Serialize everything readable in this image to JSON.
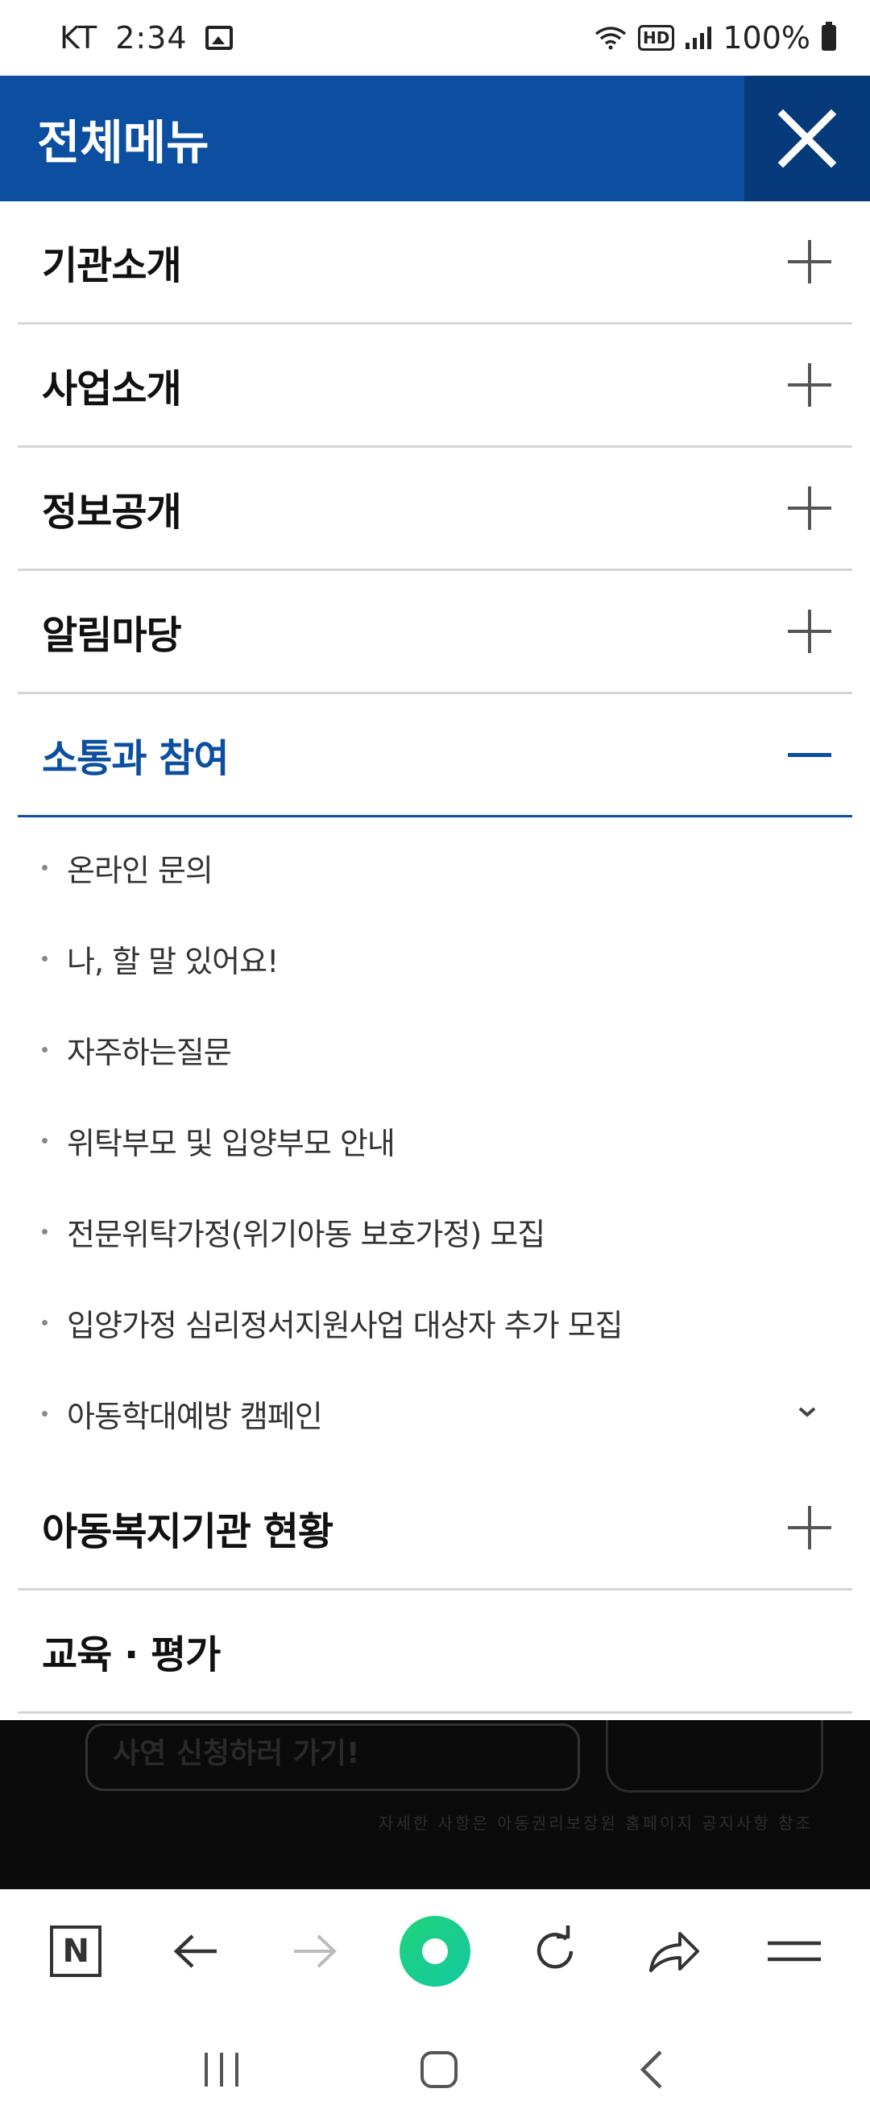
{
  "status_bar": {
    "carrier": "KT",
    "time": "2:34",
    "battery": "100%"
  },
  "header": {
    "title": "전체메뉴"
  },
  "menu": {
    "items": [
      {
        "label": "기관소개"
      },
      {
        "label": "사업소개"
      },
      {
        "label": "정보공개"
      },
      {
        "label": "알림마당"
      },
      {
        "label": "소통과 참여"
      },
      {
        "label": "아동복지기관 현황"
      },
      {
        "label": "교육 · 평가"
      }
    ],
    "submenu": [
      {
        "label": "온라인 문의"
      },
      {
        "label": "나, 할 말 있어요!"
      },
      {
        "label": "자주하는질문"
      },
      {
        "label": "위탁부모 및 입양부모 안내"
      },
      {
        "label": "전문위탁가정(위기아동 보호가정) 모집"
      },
      {
        "label": "입양가정 심리정서지원사업 대상자 추가 모집"
      },
      {
        "label": "아동학대예방 캠페인"
      }
    ]
  },
  "backdrop": {
    "pill_text": "사연 신청하러 가기!",
    "small_text": "자세한 사항은 아동권리보장원 홈페이지 공지사항 참조"
  },
  "browser": {
    "n_label": "N"
  },
  "colors": {
    "brand": "#0c4fa0",
    "close_bg": "#063a7a",
    "accent_green": "#1ed37a"
  }
}
